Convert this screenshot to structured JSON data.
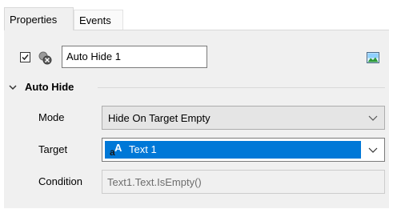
{
  "tabs": [
    {
      "label": "Properties",
      "active": true
    },
    {
      "label": "Events",
      "active": false
    }
  ],
  "component": {
    "enabled": true,
    "name": "Auto Hide 1",
    "icon": "auto-hide-component-icon",
    "image_icon": "image-icon"
  },
  "section": {
    "title": "Auto Hide",
    "expanded": true
  },
  "fields": {
    "mode": {
      "label": "Mode",
      "value": "Hide On Target Empty"
    },
    "target": {
      "label": "Target",
      "value": "Text 1",
      "icon": "text-object-icon"
    },
    "condition": {
      "label": "Condition",
      "value": "Text1.Text.IsEmpty()"
    }
  },
  "colors": {
    "selection": "#0078d7",
    "panel_bg": "#f0f0f0"
  }
}
